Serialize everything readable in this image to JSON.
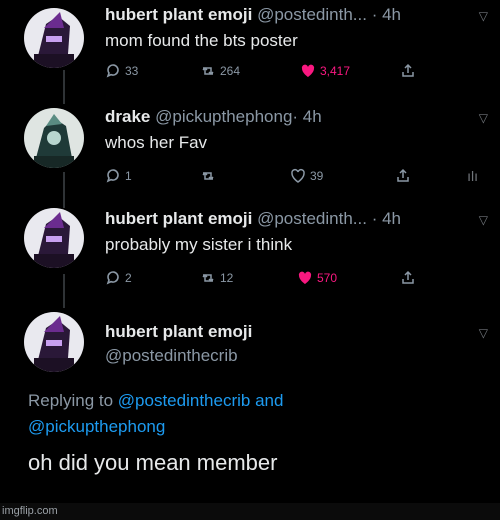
{
  "tweets": [
    {
      "name": "hubert plant emoji",
      "handle": "@postedinth...",
      "time": "· 4h",
      "text": "mom found the bts poster",
      "replies": "33",
      "retweets": "264",
      "likes": "3,417"
    },
    {
      "name": "drake",
      "handle": "@pickupthephong",
      "time": "· 4h",
      "text": "whos her Fav",
      "replies": "1",
      "retweets": "",
      "likes": "39"
    },
    {
      "name": "hubert plant emoji",
      "handle": "@postedinth...",
      "time": "· 4h",
      "text": "probably my sister i think",
      "replies": "2",
      "retweets": "12",
      "likes": "570"
    }
  ],
  "main": {
    "name": "hubert plant emoji",
    "handle": "@postedinthecrib",
    "replying_prefix": "Replying to",
    "replying_user1": "@postedinthecrib",
    "replying_and": "and",
    "replying_user2": "@pickupthephong",
    "text": "oh did you mean member"
  },
  "watermark": "imgflip.com",
  "colors": {
    "like": "#f91880",
    "link": "#1d9bf0",
    "muted": "#8b98a5"
  }
}
